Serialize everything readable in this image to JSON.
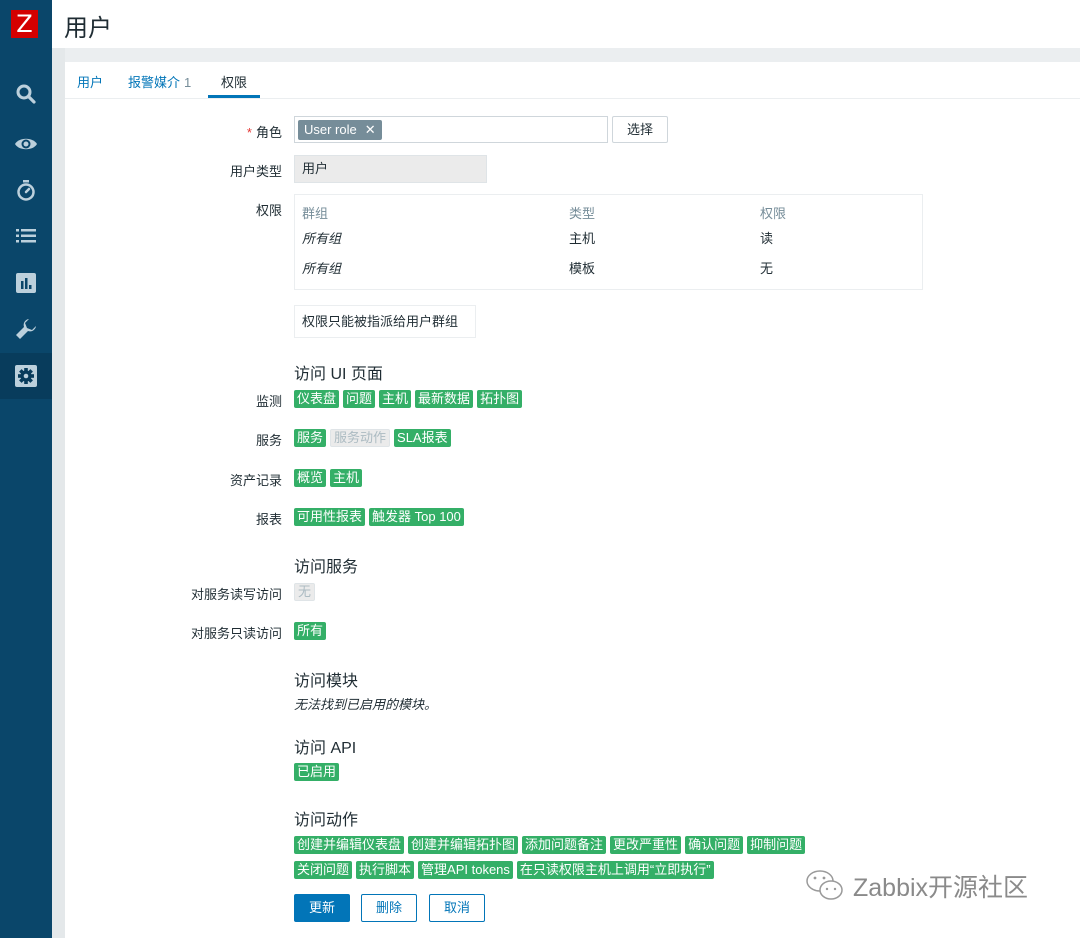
{
  "app": {
    "logo": "Z",
    "page_title": "用户"
  },
  "sidebar": {
    "items": [
      {
        "icon": "search-icon",
        "label": "Search"
      },
      {
        "icon": "eye-icon",
        "label": "Monitoring"
      },
      {
        "icon": "stopwatch-icon",
        "label": "Services"
      },
      {
        "icon": "list-icon",
        "label": "Inventory"
      },
      {
        "icon": "bar-chart-icon",
        "label": "Reports"
      },
      {
        "icon": "wrench-icon",
        "label": "Data collection"
      },
      {
        "icon": "gear-icon",
        "label": "Administration",
        "active": true
      }
    ]
  },
  "tabs": [
    {
      "label": "用户"
    },
    {
      "label": "报警媒介",
      "count": "1"
    },
    {
      "label": "权限",
      "active": true
    }
  ],
  "form": {
    "role": {
      "label": "角色",
      "required_mark": "*",
      "value": "User role",
      "select_button": "选择"
    },
    "user_type": {
      "label": "用户类型",
      "value": "用户"
    },
    "permissions": {
      "label": "权限",
      "headers": [
        "群组",
        "类型",
        "权限"
      ],
      "rows": [
        {
          "group": "所有组",
          "type": "主机",
          "permission": "读"
        },
        {
          "group": "所有组",
          "type": "模板",
          "permission": "无"
        }
      ],
      "note": "权限只能被指派给用户群组"
    },
    "ui_access": {
      "title": "访问 UI 页面",
      "groups": [
        {
          "label": "监测",
          "tags": [
            {
              "text": "仪表盘",
              "enabled": true
            },
            {
              "text": "问题",
              "enabled": true
            },
            {
              "text": "主机",
              "enabled": true
            },
            {
              "text": "最新数据",
              "enabled": true
            },
            {
              "text": "拓扑图",
              "enabled": true
            }
          ]
        },
        {
          "label": "服务",
          "tags": [
            {
              "text": "服务",
              "enabled": true
            },
            {
              "text": "服务动作",
              "enabled": false
            },
            {
              "text": "SLA报表",
              "enabled": true
            }
          ]
        },
        {
          "label": "资产记录",
          "tags": [
            {
              "text": "概览",
              "enabled": true
            },
            {
              "text": "主机",
              "enabled": true
            }
          ]
        },
        {
          "label": "报表",
          "tags": [
            {
              "text": "可用性报表",
              "enabled": true
            },
            {
              "text": "触发器 Top 100",
              "enabled": true
            }
          ]
        }
      ]
    },
    "service_access": {
      "title": "访问服务",
      "read_write": {
        "label": "对服务读写访问",
        "value": "无",
        "enabled": false
      },
      "read_only": {
        "label": "对服务只读访问",
        "value": "所有",
        "enabled": true
      }
    },
    "module_access": {
      "title": "访问模块",
      "empty_text": "无法找到已启用的模块。"
    },
    "api_access": {
      "title": "访问 API",
      "value": "已启用"
    },
    "action_access": {
      "title": "访问动作",
      "row1": [
        "创建并编辑仪表盘",
        "创建并编辑拓扑图",
        "添加问题备注",
        "更改严重性",
        "确认问题",
        "抑制问题"
      ],
      "row2": [
        "关闭问题",
        "执行脚本",
        "管理API tokens",
        "在只读权限主机上调用“立即执行”"
      ]
    },
    "buttons": {
      "update": "更新",
      "delete": "删除",
      "cancel": "取消"
    }
  },
  "watermark": {
    "text": "Zabbix开源社区"
  },
  "colors": {
    "sidebar": "#0a466a",
    "accent": "#0275b8",
    "tag_green": "#34af67",
    "logo_red": "#d40000"
  }
}
